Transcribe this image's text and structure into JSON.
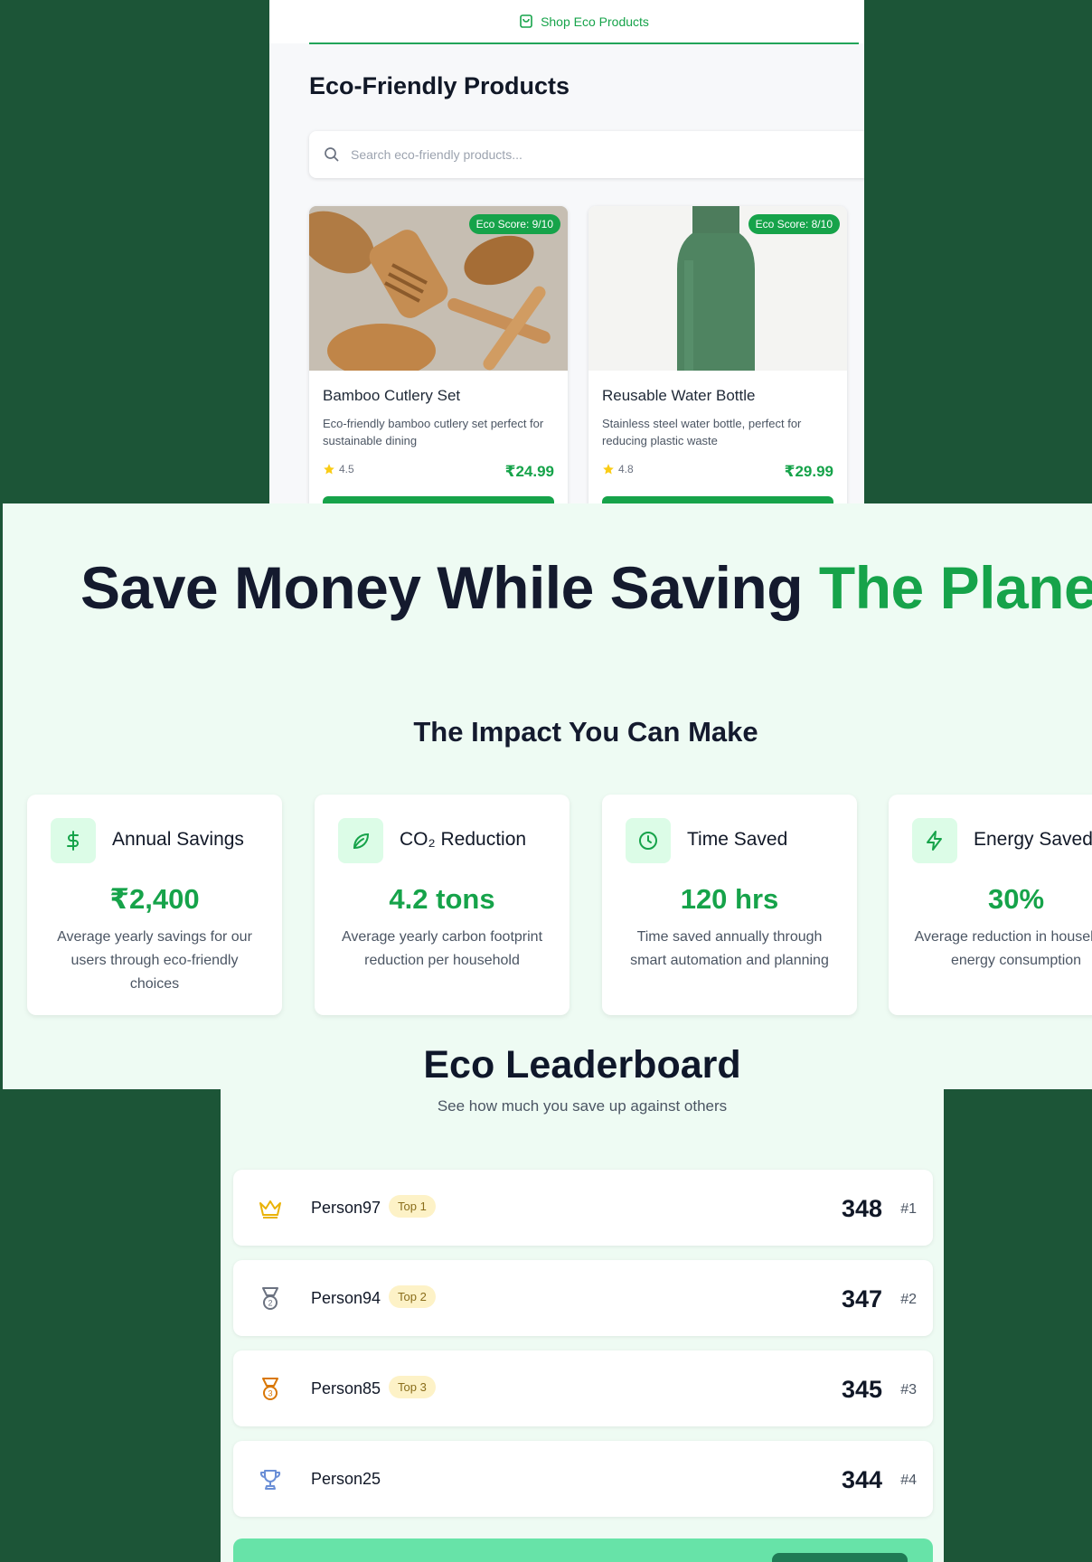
{
  "products": {
    "tab_label": "Shop Eco Products",
    "title": "Eco-Friendly Products",
    "search_placeholder": "Search eco-friendly products...",
    "items": [
      {
        "badge": "Eco Score: 9/10",
        "name": "Bamboo Cutlery Set",
        "description": "Eco-friendly bamboo cutlery set perfect for sustainable dining",
        "rating": "4.5",
        "price": "₹24.99"
      },
      {
        "badge": "Eco Score: 8/10",
        "name": "Reusable Water Bottle",
        "description": "Stainless steel water bottle, perfect for reducing plastic waste",
        "rating": "4.8",
        "price": "₹29.99"
      }
    ]
  },
  "hero": {
    "title_main": "Save Money While Saving ",
    "title_accent": "The Planet"
  },
  "impact": {
    "title": "The Impact You Can Make",
    "stats": [
      {
        "icon": "dollar-icon",
        "label": "Annual Savings",
        "value": "₹2,400",
        "description": "Average yearly savings for our users through eco-friendly choices"
      },
      {
        "icon": "leaf-icon",
        "label": "CO₂ Reduction",
        "value": "4.2 tons",
        "description": "Average yearly carbon footprint reduction per household"
      },
      {
        "icon": "clock-icon",
        "label": "Time Saved",
        "value": "120 hrs",
        "description": "Time saved annually through smart automation and planning"
      },
      {
        "icon": "lightning-icon",
        "label": "Energy Saved",
        "value": "30%",
        "description": "Average reduction in household energy consumption"
      }
    ]
  },
  "leaderboard": {
    "title": "Eco Leaderboard",
    "subtitle": "See how much you save up against others",
    "rows": [
      {
        "icon": "crown-icon",
        "name": "Person97",
        "tag": "Top 1",
        "score": "348",
        "rank": "#1"
      },
      {
        "icon": "medal-silver-icon",
        "name": "Person94",
        "tag": "Top 2",
        "score": "347",
        "rank": "#2"
      },
      {
        "icon": "medal-bronze-icon",
        "name": "Person85",
        "tag": "Top 3",
        "score": "345",
        "rank": "#3"
      },
      {
        "icon": "trophy-icon",
        "name": "Person25",
        "tag": "",
        "score": "344",
        "rank": "#4"
      }
    ]
  },
  "colors": {
    "accent": "#16a34a",
    "background": "#1c5537",
    "panel": "#eefbf3"
  }
}
